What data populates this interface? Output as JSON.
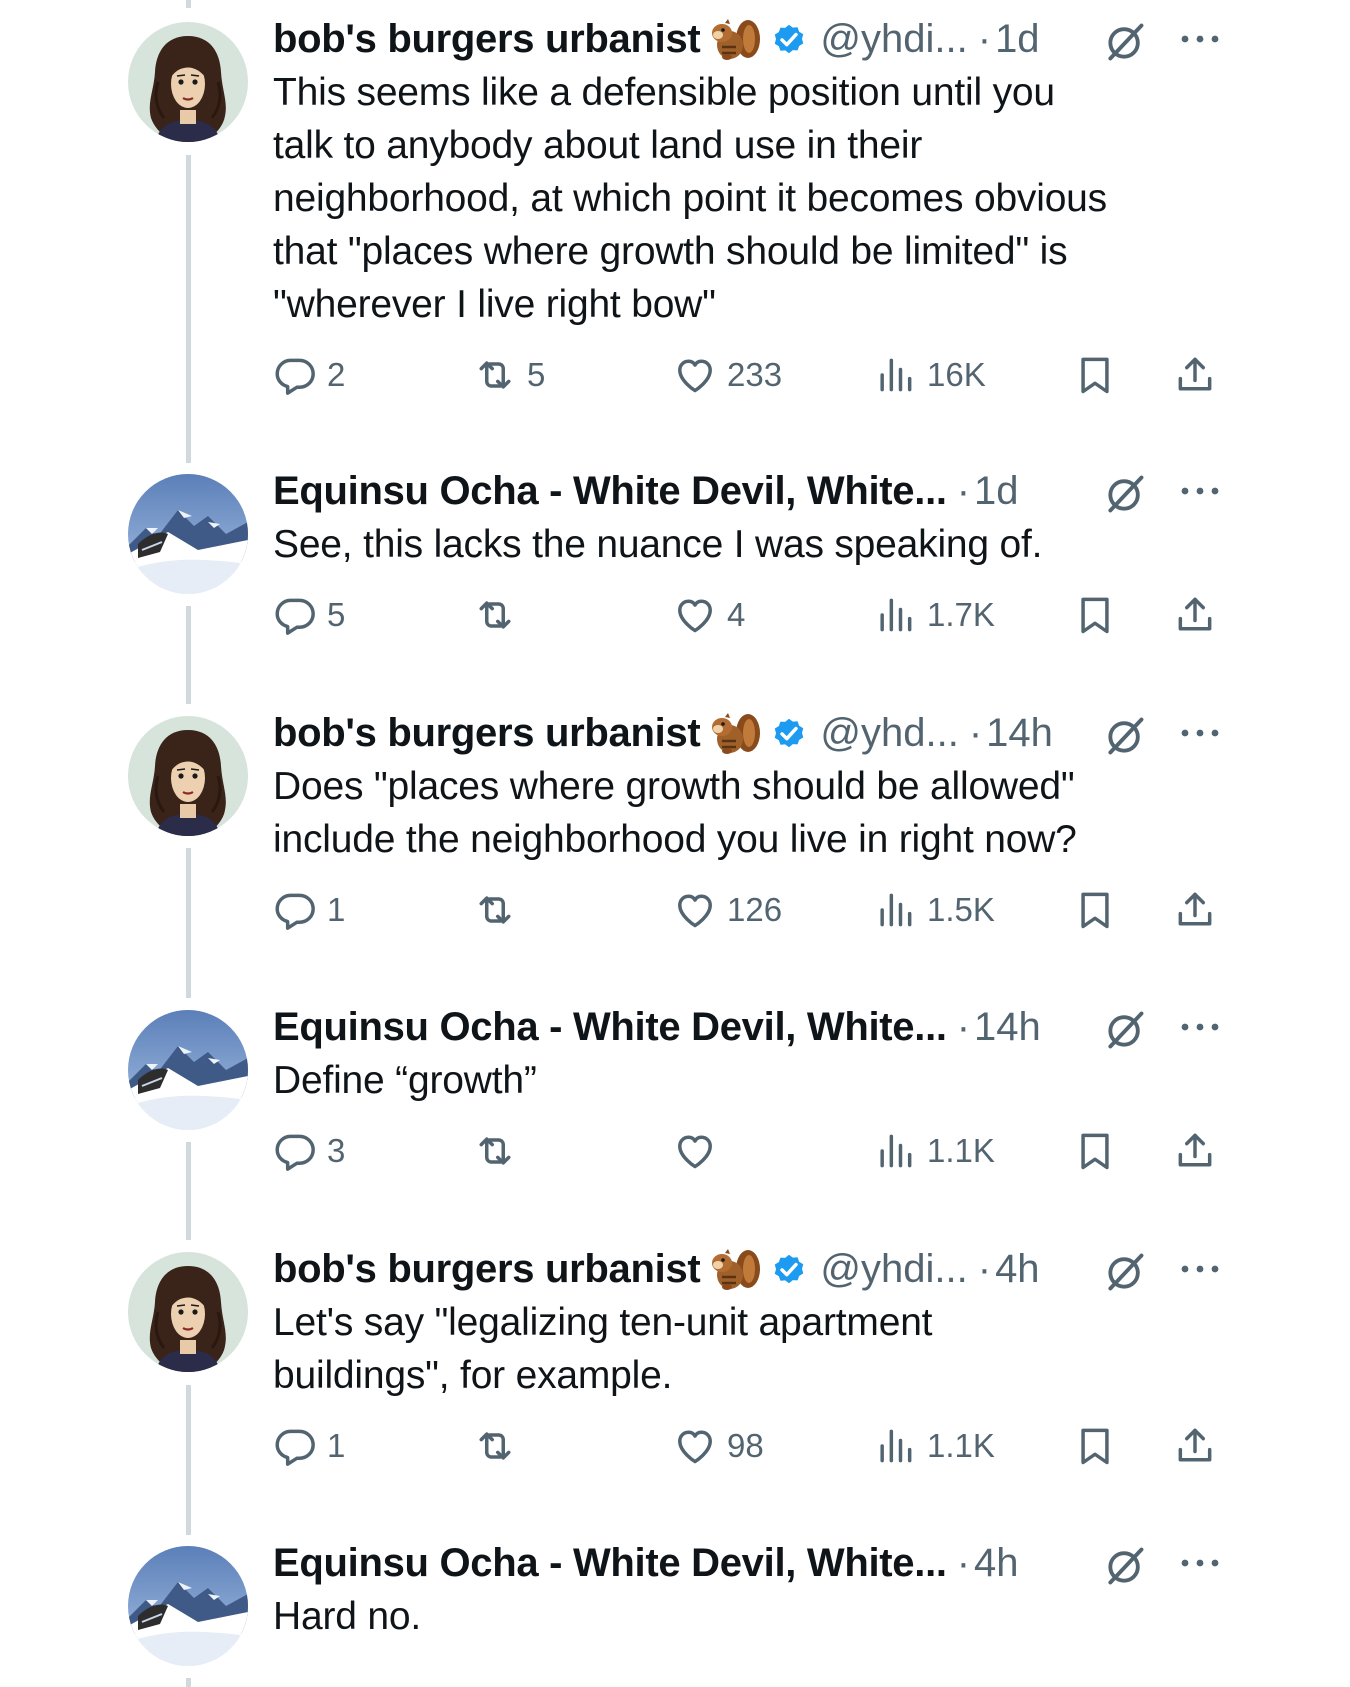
{
  "tweets": [
    {
      "author": "bob",
      "name": "bob's burgers urbanist",
      "emoji": "chipmunk-emoji",
      "verified": true,
      "handle": "@yhdi...",
      "dot": "·",
      "time": "1d",
      "text": "This seems like a defensible position until you\ntalk to anybody about land use in their\nneighborhood, at which point it becomes obvious\nthat \"places where growth should be limited\" is\n\"wherever I live right bow\"",
      "replies": "2",
      "retweets": "5",
      "likes": "233",
      "views": "16K"
    },
    {
      "author": "equinsu",
      "name": "Equinsu Ocha - White Devil, White...",
      "verified": false,
      "handle": "",
      "dot": "·",
      "time": "1d",
      "text": "See, this lacks the nuance I was speaking of.",
      "replies": "5",
      "retweets": "",
      "likes": "4",
      "views": "1.7K"
    },
    {
      "author": "bob",
      "name": "bob's burgers urbanist",
      "emoji": "chipmunk-emoji",
      "verified": true,
      "handle": "@yhd...",
      "dot": "·",
      "time": "14h",
      "text": "Does \"places where growth should be allowed\"\ninclude the neighborhood you live in right now?",
      "replies": "1",
      "retweets": "",
      "likes": "126",
      "views": "1.5K"
    },
    {
      "author": "equinsu",
      "name": "Equinsu Ocha - White Devil, White...",
      "verified": false,
      "handle": "",
      "dot": "·",
      "time": "14h",
      "text": "Define “growth”",
      "replies": "3",
      "retweets": "",
      "likes": "",
      "views": "1.1K"
    },
    {
      "author": "bob",
      "name": "bob's burgers urbanist",
      "emoji": "chipmunk-emoji",
      "verified": true,
      "handle": "@yhdi...",
      "dot": "·",
      "time": "4h",
      "text": "Let's say \"legalizing ten-unit apartment\nbuildings\", for example.",
      "replies": "1",
      "retweets": "",
      "likes": "98",
      "views": "1.1K"
    },
    {
      "author": "equinsu",
      "name": "Equinsu Ocha - White Devil, White...",
      "verified": false,
      "handle": "",
      "dot": "·",
      "time": "4h",
      "text": "Hard no."
    }
  ],
  "colors": {
    "text": "#0f1419",
    "secondary": "#536471",
    "verified": "#1d9bf0",
    "thread_line": "#cfd9de"
  },
  "icons": [
    "reply-icon",
    "retweet-icon",
    "like-icon",
    "views-icon",
    "bookmark-icon",
    "share-icon",
    "grok-icon",
    "more-icon",
    "verified-badge-icon"
  ]
}
